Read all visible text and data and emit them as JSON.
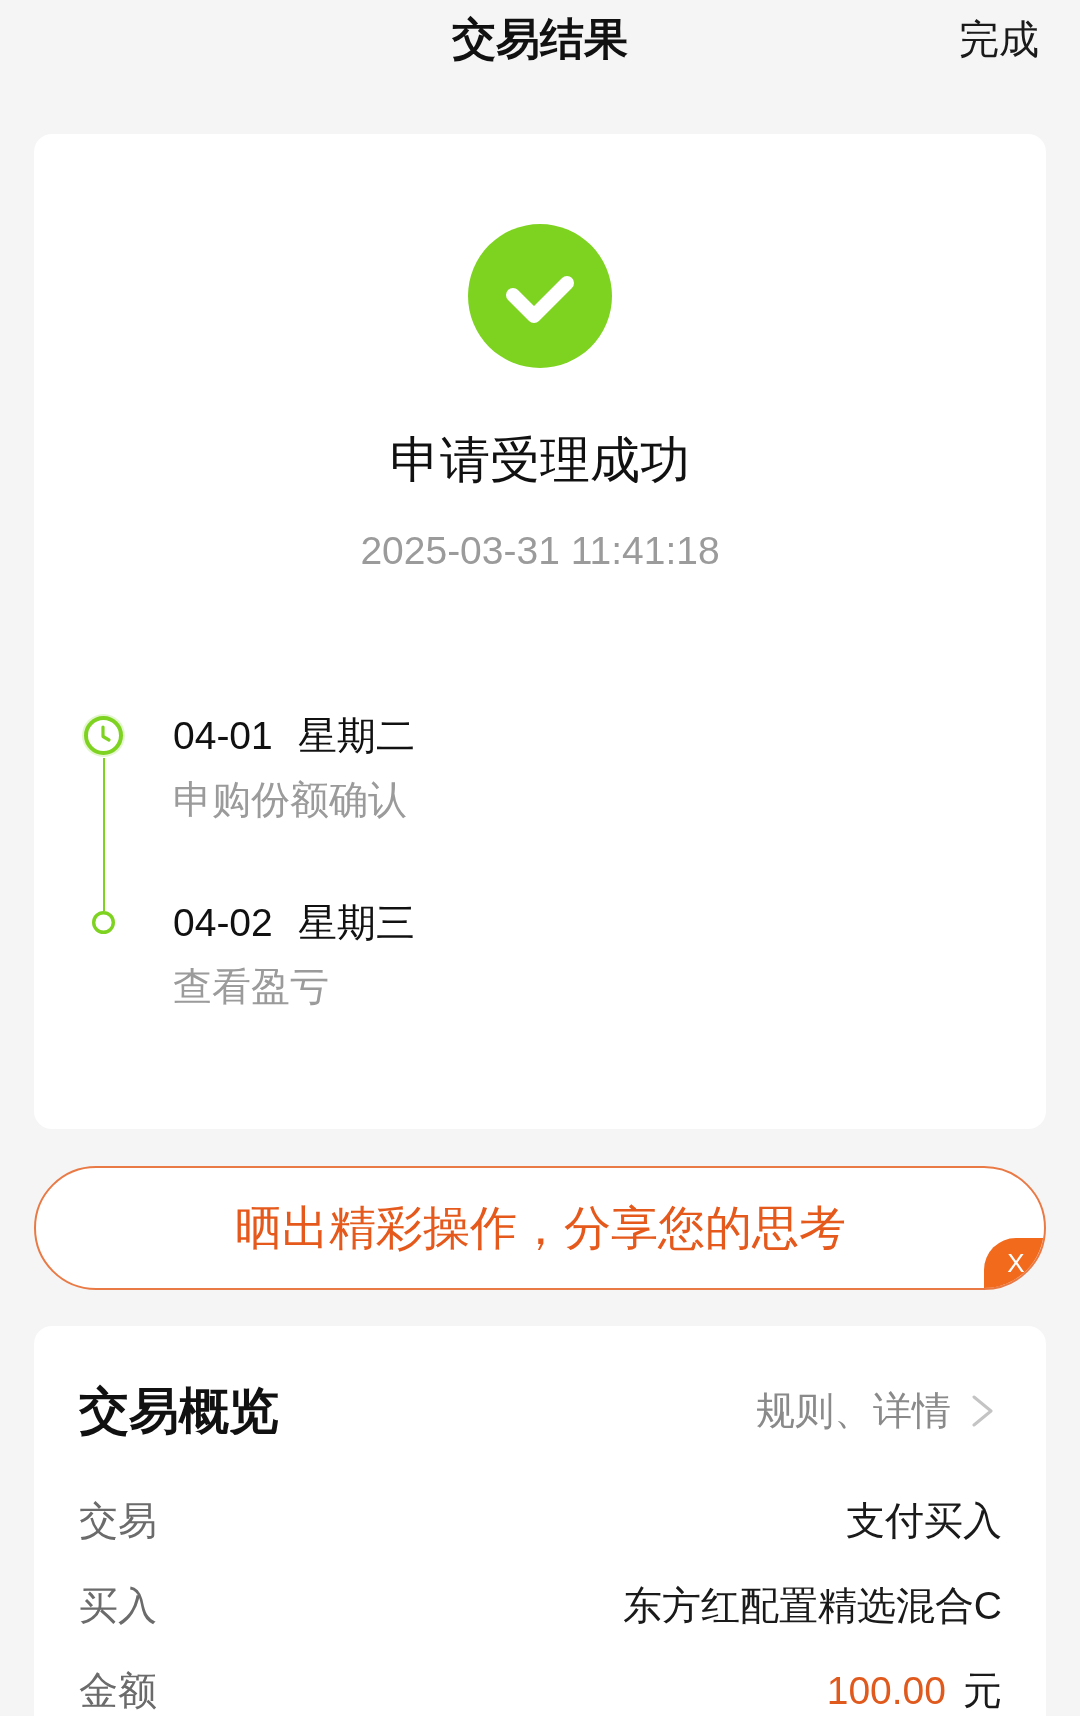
{
  "header": {
    "title": "交易结果",
    "action": "完成"
  },
  "result": {
    "status": "申请受理成功",
    "time": "2025-03-31 11:41:18"
  },
  "timeline": [
    {
      "kind": "clock",
      "date": "04-01",
      "weekday": "星期二",
      "desc": "申购份额确认"
    },
    {
      "kind": "dot",
      "date": "04-02",
      "weekday": "星期三",
      "desc": "查看盈亏"
    }
  ],
  "banner": {
    "text": "晒出精彩操作，分享您的思考",
    "close": "X"
  },
  "overview": {
    "title": "交易概览",
    "link": "规则、详情",
    "rows": [
      {
        "kind": "text",
        "label": "交易",
        "value": "支付买入"
      },
      {
        "kind": "text",
        "label": "买入",
        "value": "东方红配置精选混合C"
      },
      {
        "kind": "amount",
        "label": "金额",
        "value": "100.00",
        "unit": "元"
      }
    ]
  }
}
